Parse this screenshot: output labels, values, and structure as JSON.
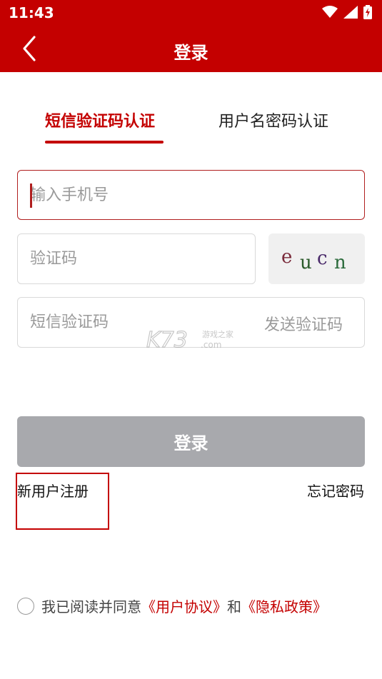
{
  "status_bar": {
    "time": "11:43",
    "icons": [
      "wifi-icon",
      "cell-signal-icon",
      "battery-charging-icon"
    ]
  },
  "header": {
    "title": "登录",
    "back_icon": "chevron-left-icon"
  },
  "tabs": [
    {
      "label": "短信验证码认证",
      "active": true
    },
    {
      "label": "用户名密码认证",
      "active": false
    }
  ],
  "form": {
    "phone_placeholder": "输入手机号",
    "code_placeholder": "验证码",
    "captcha": [
      "e",
      "u",
      "c",
      "n"
    ],
    "sms_placeholder": "短信验证码",
    "send_code_label": "发送验证码"
  },
  "watermark": {
    "brand": "K73",
    "subtitle": "游戏之家",
    "domain": ".com"
  },
  "login_button": "登录",
  "links": {
    "register": "新用户注册",
    "forgot": "忘记密码"
  },
  "agreement": {
    "prefix": "我已阅读并同意",
    "user_agreement": "《用户协议》",
    "conj": "和",
    "privacy_policy": "《隐私政策》"
  },
  "colors": {
    "brand_red": "#c40000",
    "disabled_button": "#a8a9ad"
  }
}
